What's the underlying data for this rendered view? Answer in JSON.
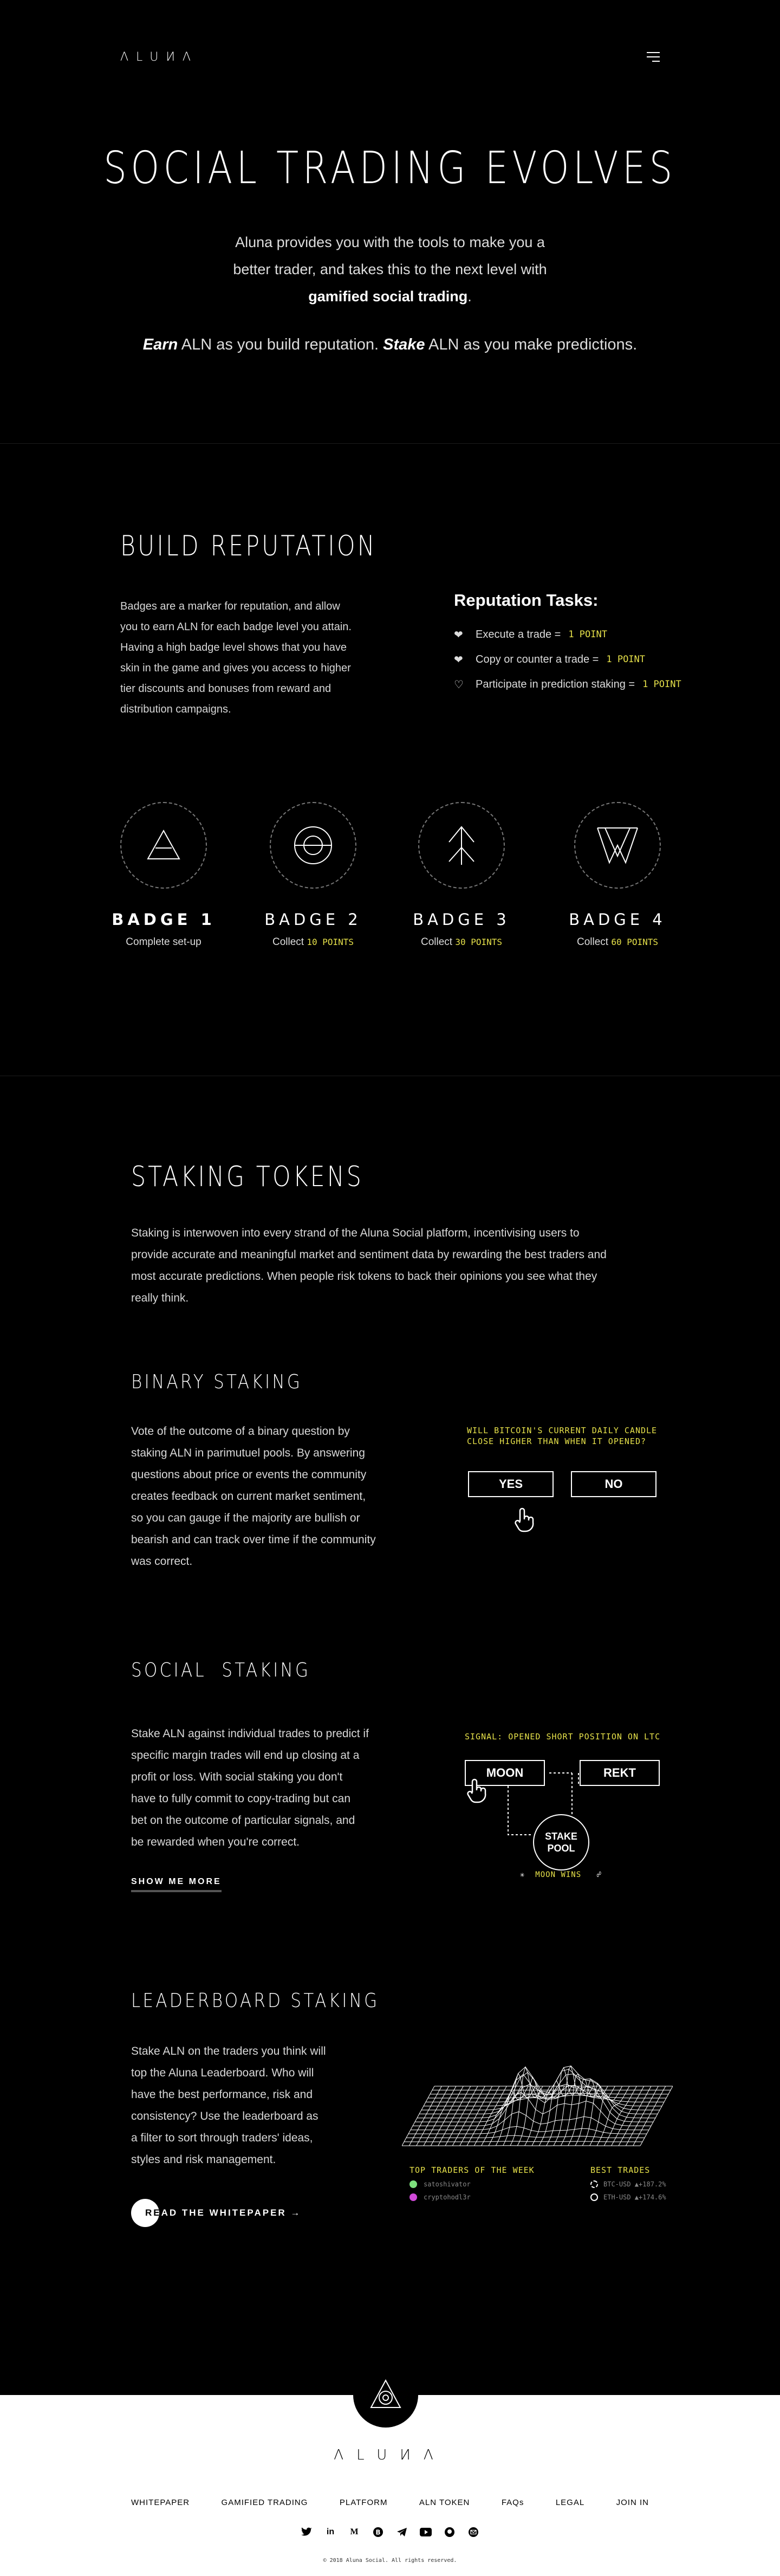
{
  "header": {
    "logo": "ΛLUИΛ",
    "menu_icon": "hamburger-menu-icon"
  },
  "hero": {
    "title": "SOCIAL TRADING EVOLVES",
    "sub_line1": "Aluna provides you with the tools to make you a",
    "sub_line2": "better trader, and takes this to the next level with",
    "sub_bold": "gamified social trading",
    "sub_end": ".",
    "earn": "Earn",
    "earn_text": " ALN as you build reputation. ",
    "stake": "Stake",
    "stake_text": " ALN as you make predictions."
  },
  "reputation": {
    "title": "BUILD REPUTATION",
    "body": [
      "Badges are a marker for reputation, and allow",
      "you to earn ALN for each badge level you attain.",
      "Having a high badge level shows that you have",
      "skin in the game and gives you access to higher",
      "tier discounts and bonuses from reward and",
      "distribution campaigns."
    ],
    "tasks_title": "Reputation Tasks:",
    "tasks": [
      {
        "label": "Execute a trade = ",
        "points": "1 POINT"
      },
      {
        "label": "Copy or counter a trade = ",
        "points": "1 POINT"
      },
      {
        "label": "Participate in prediction staking = ",
        "points": "1 POINT"
      }
    ],
    "badges": [
      {
        "name": "BADGE 1",
        "desc": "Complete set-up",
        "points": ""
      },
      {
        "name": "BADGE 2",
        "desc": "Collect ",
        "points": "10 POINTS"
      },
      {
        "name": "BADGE 3",
        "desc": "Collect ",
        "points": "30 POINTS"
      },
      {
        "name": "BADGE 4",
        "desc": "Collect ",
        "points": "60 POINTS"
      }
    ]
  },
  "staking": {
    "title": "STAKING TOKENS",
    "intro": [
      "Staking is interwoven into every strand of the Aluna Social platform, incentivising users to",
      "provide accurate and meaningful market and sentiment data by rewarding the best traders and",
      "most accurate predictions. When people risk tokens to back their opinions you see what they",
      "really think."
    ]
  },
  "binary": {
    "title": "BINARY STAKING",
    "body": [
      "Vote of the outcome of a binary question by",
      "staking ALN in parimutuel pools. By answering",
      "questions about price or events the community",
      "creates feedback on current market sentiment,",
      "so you can gauge if the majority are bullish or",
      "bearish and can track over time if the community",
      "was correct."
    ],
    "question_line1": "WILL BITCOIN'S CURRENT DAILY CANDLE",
    "question_line2": "CLOSE HIGHER THAN WHEN IT OPENED?",
    "yes": "YES",
    "no": "NO"
  },
  "social": {
    "title": "SOCIAL  STAKING",
    "body": [
      "Stake ALN against individual trades to predict if",
      "specific margin trades will end up closing at a",
      "profit or loss. With social staking you don't",
      "have to fully commit to copy-trading but can",
      "bet on the outcome of particular signals, and",
      "be rewarded when you're correct."
    ],
    "show_more": "SHOW ME MORE",
    "signal": "SIGNAL: OPENED SHORT POSITION ON LTC",
    "moon": "MOON",
    "rekt": "REKT",
    "pool_line1": "STAKE",
    "pool_line2": "POOL",
    "moon_wins": "MOON WINS"
  },
  "leaderboard": {
    "title": "LEADERBOARD STAKING",
    "body": [
      "Stake ALN on the traders you think will",
      "top the Aluna Leaderboard. Who will",
      "have the best performance, risk and",
      "consistency? Use the leaderboard as",
      "a filter to sort through traders' ideas,",
      "styles and risk management."
    ],
    "top_traders_label": "TOP TRADERS OF THE WEEK",
    "traders": [
      "satoshivator",
      "cryptohodl3r"
    ],
    "best_trades_label": "BEST TRADES",
    "trades": [
      "BTC-USD ▲+187.2%",
      "ETH-USD ▲+174.6%"
    ],
    "trader_colors": [
      "#7ee07e",
      "#d04ad8"
    ],
    "read_whitepaper": "READ THE WHITEPAPER →"
  },
  "footer": {
    "wordmark": "ΛLUИΛ",
    "nav": [
      "WHITEPAPER",
      "GAMIFIED TRADING",
      "PLATFORM",
      "ALN TOKEN",
      "FAQs",
      "LEGAL",
      "JOIN IN"
    ],
    "socials": [
      "twitter-icon",
      "linkedin-icon",
      "medium-icon",
      "bitcointalk-icon",
      "telegram-icon",
      "youtube-icon",
      "github-icon",
      "email-icon"
    ],
    "copyright": "© 2018 Aluna Social. All rights reserved."
  },
  "colors": {
    "accent": "#e6e14a",
    "background": "#000000",
    "footer_bg": "#ffffff"
  }
}
